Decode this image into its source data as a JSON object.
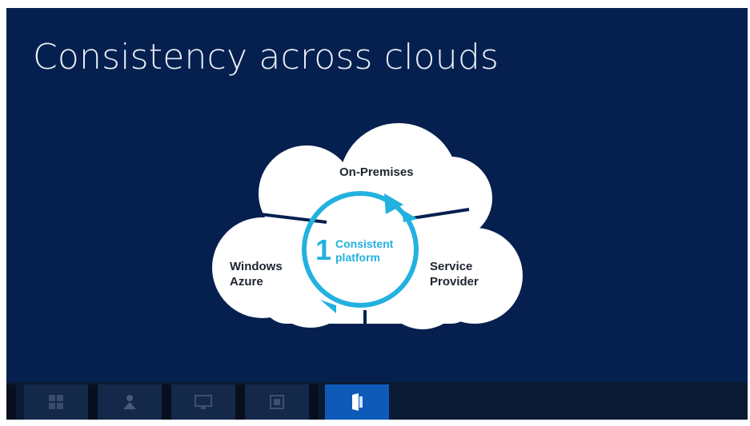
{
  "slide": {
    "title": "Consistency across clouds"
  },
  "diagram": {
    "top_label": "On-Premises",
    "left_label_line1": "Windows",
    "left_label_line2": "Azure",
    "right_label_line1": "Service",
    "right_label_line2": "Provider",
    "center_number": "1",
    "center_line1": "Consistent",
    "center_line2": "platform"
  },
  "taskbar": {
    "items": [
      {
        "icon": "windows-logo-icon"
      },
      {
        "icon": "person-icon"
      },
      {
        "icon": "monitor-icon"
      },
      {
        "icon": "panel-icon"
      },
      {
        "icon": "server-icon"
      }
    ],
    "active_index": 4
  },
  "colors": {
    "slide_bg": "#05204f",
    "accent_cyan": "#23b1df",
    "cloud_white": "#ffffff",
    "taskbar_active": "#0e5ab8"
  }
}
